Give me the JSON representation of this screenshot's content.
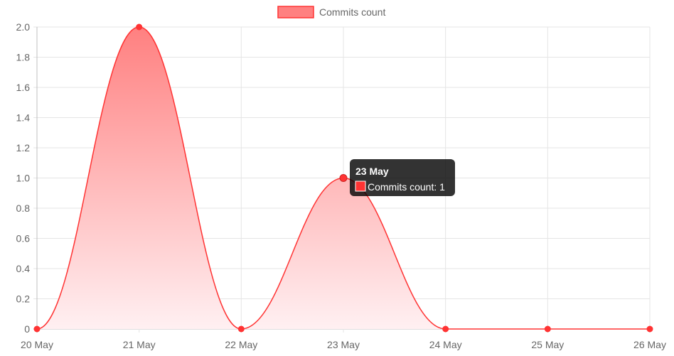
{
  "chart_data": {
    "type": "area",
    "x": [
      "20 May",
      "21 May",
      "22 May",
      "23 May",
      "24 May",
      "25 May",
      "26 May"
    ],
    "series": [
      {
        "name": "Commits count",
        "values": [
          0,
          2,
          0,
          1,
          0,
          0,
          0
        ]
      }
    ],
    "ylim": [
      0,
      2.0
    ],
    "y_ticks": [
      "0",
      "0.2",
      "0.4",
      "0.6",
      "0.8",
      "1.0",
      "1.2",
      "1.4",
      "1.6",
      "1.8",
      "2.0"
    ],
    "grid": true,
    "legend_position": "top",
    "colors": {
      "line": "#ff3333",
      "fill_top": "#ff8080",
      "fill_bottom": "#fff0f2",
      "grid": "#e5e5e5",
      "axis": "#bfbfbf"
    },
    "tooltip": {
      "title": "23 May",
      "label": "Commits count: 1",
      "index": 3
    }
  }
}
